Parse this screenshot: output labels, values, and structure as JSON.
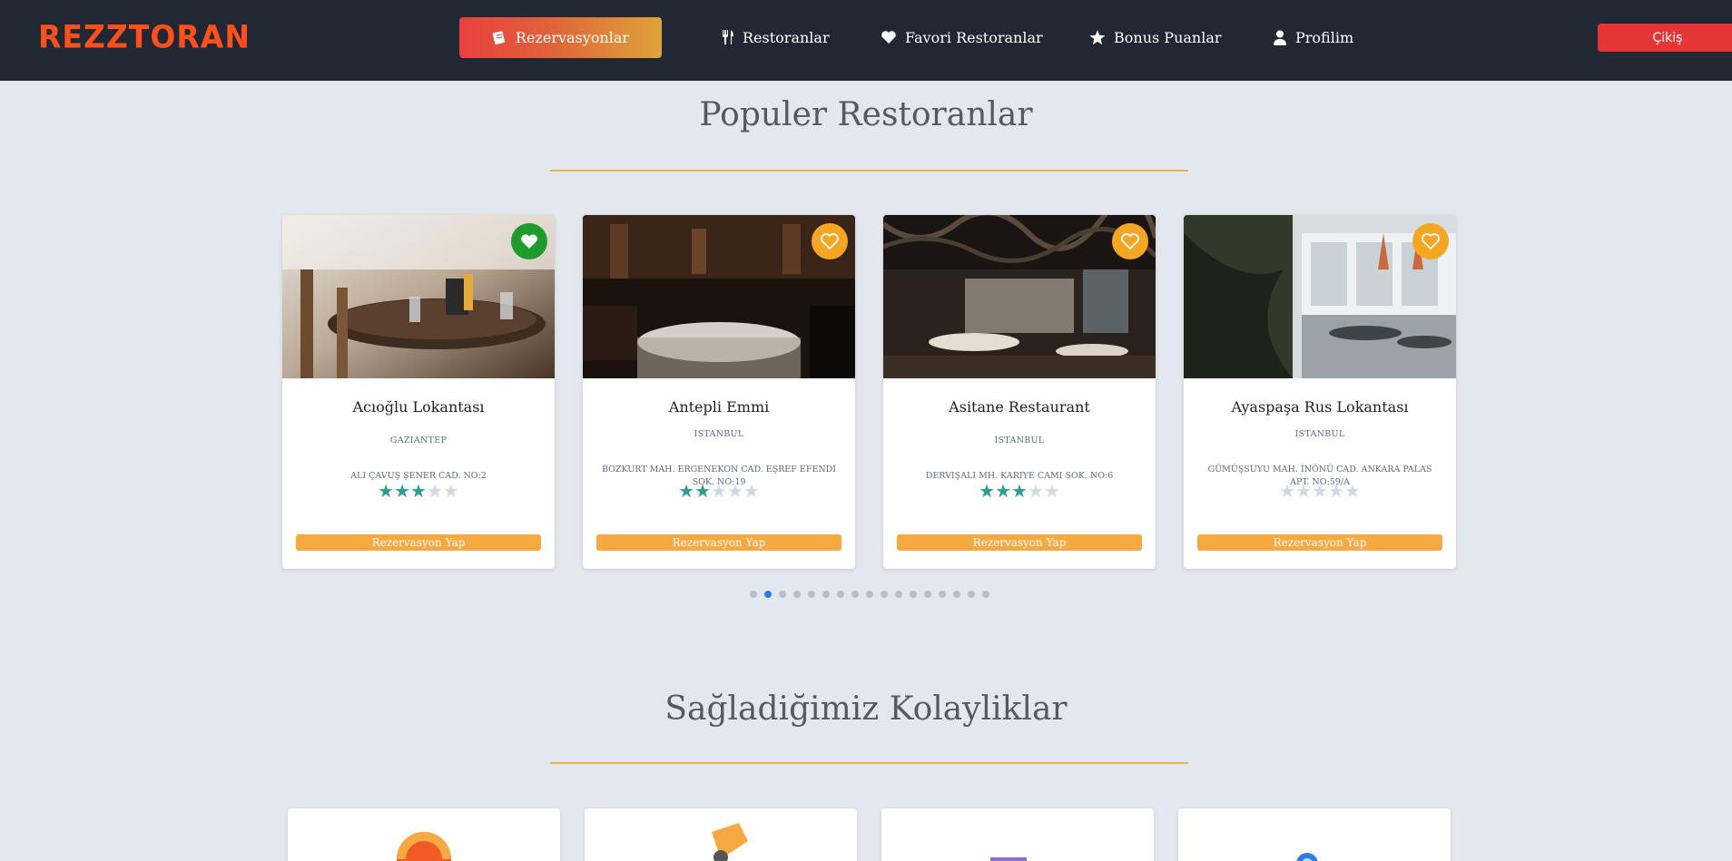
{
  "brand": "REZZTORAN",
  "nav": {
    "active": {
      "label": "Rezervasyonlar",
      "icon": "document-icon"
    },
    "items": [
      {
        "label": "Restoranlar",
        "icon": "fork-knife-icon"
      },
      {
        "label": "Favori Restoranlar",
        "icon": "heart-icon"
      },
      {
        "label": "Bonus Puanlar",
        "icon": "star-icon"
      },
      {
        "label": "Profilim",
        "icon": "user-icon"
      }
    ],
    "logout": "Çikiş"
  },
  "popular": {
    "title": "Populer Restoranlar",
    "reserve_label": "Rezervasyon Yap",
    "restaurants": [
      {
        "name": "Acıoğlu Lokantası",
        "city": "GAZIANTEP",
        "address": "ALI ÇAVUŞ ŞENER CAD. NO:2",
        "rating": 3,
        "favorite": true
      },
      {
        "name": "Antepli Emmi",
        "city": "ISTANBUL",
        "address": "BOZKURT MAH. ERGENEKON CAD. EŞREF EFENDI SOK. NO:19",
        "rating": 2,
        "favorite": false
      },
      {
        "name": "Asitane Restaurant",
        "city": "ISTANBUL",
        "address": "DERVIŞALI MH. KARIYE CAMI SOK. NO:6",
        "rating": 3,
        "favorite": false
      },
      {
        "name": "Ayaspaşa Rus Lokantası",
        "city": "ISTANBUL",
        "address": "GÜMÜŞSUYU MAH. İNÖNÜ CAD. ANKARA PALAS APT. NO:59/A",
        "rating": 0,
        "favorite": false
      }
    ],
    "carousel": {
      "total_pages": 17,
      "active_page": 2
    }
  },
  "features": {
    "title": "Sağladiğimiz Kolayliklar",
    "icons": [
      "clock-icon",
      "hand-card-icon",
      "delivery-truck-icon",
      "location-pin-icon"
    ]
  },
  "colors": {
    "navbar": "#222833",
    "brand": "#ff4f1a",
    "accent": "#f7a941",
    "logout": "#e53535",
    "star_on": "#2f9c8e",
    "favorite_active": "#1f9b2e",
    "favorite_idle": "#f5a623"
  }
}
